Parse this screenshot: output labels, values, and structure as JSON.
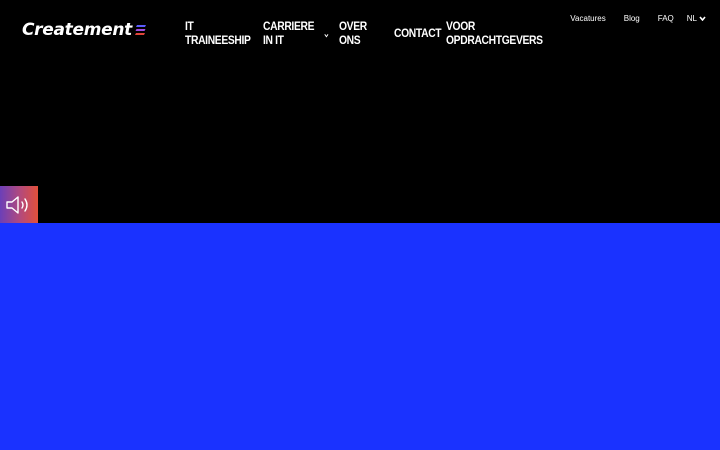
{
  "brand": {
    "logo_text": "Createment",
    "mark_colors": [
      "#5b5bff",
      "#a04de0",
      "#e0453a"
    ]
  },
  "nav": {
    "items": [
      {
        "label": "IT Traineeship",
        "has_dropdown": true
      },
      {
        "label": "Carriere in IT",
        "has_dropdown": true
      },
      {
        "label": "Over ons",
        "has_dropdown": false
      },
      {
        "label": "Contact",
        "has_dropdown": false
      },
      {
        "label": "Voor opdrachtgevers",
        "has_dropdown": false
      }
    ]
  },
  "top_nav": {
    "vacatures": "Vacatures",
    "blog": "Blog",
    "faq": "FAQ",
    "language": "NL"
  },
  "sound_button": {
    "icon": "speaker-icon"
  },
  "colors": {
    "hero_background": "#000000",
    "section_background": "#1a32ff",
    "text": "#ffffff"
  }
}
